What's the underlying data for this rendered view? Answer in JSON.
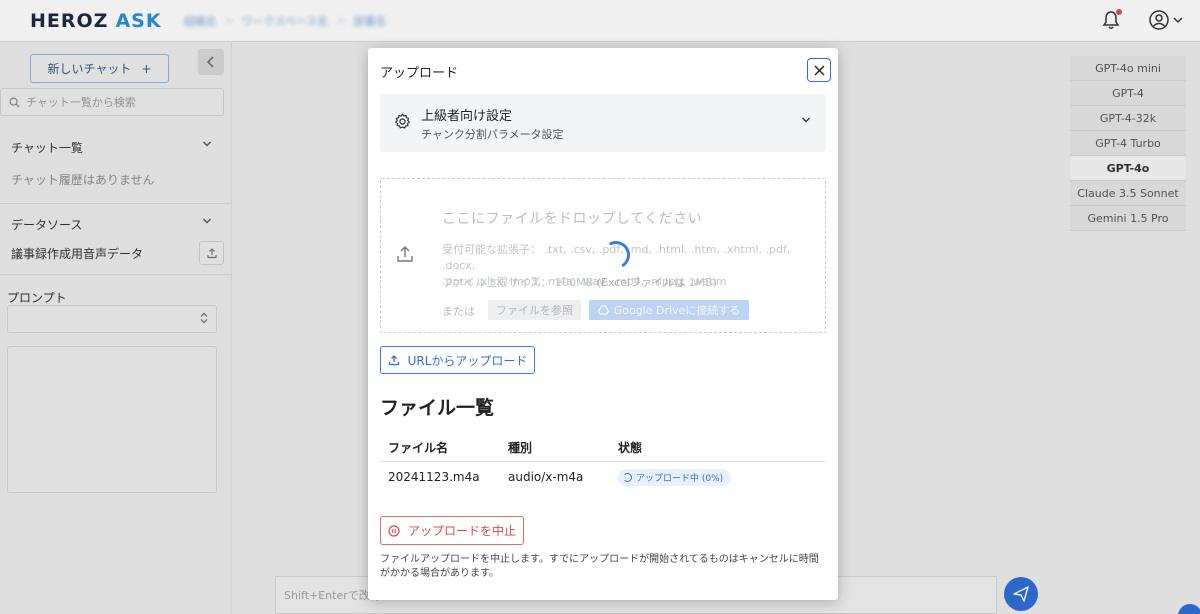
{
  "header": {
    "logo_main": "HEROZ",
    "logo_accent": "ASK",
    "breadcrumbs": [
      "組織名",
      "ワークスペース名",
      "部署名"
    ]
  },
  "sidebar": {
    "new_chat_label": "新しいチャット",
    "new_chat_plus": "+",
    "search_placeholder": "チャット一覧から検索",
    "chat_list_title": "チャット一覧",
    "chat_list_empty": "チャット履歴はありません",
    "datasource_title": "データソース",
    "datasource_item": "議事録作成用音声データ",
    "prompt_title": "プロンプト"
  },
  "main": {
    "input_placeholder": "Shift+Enterで改行"
  },
  "models": [
    "GPT-4o mini",
    "GPT-4",
    "GPT-4-32k",
    "GPT-4 Turbo",
    "GPT-4o",
    "Claude 3.5 Sonnet",
    "Gemini 1.5 Pro"
  ],
  "active_model_index": 4,
  "modal": {
    "title": "アップロード",
    "advanced": {
      "title": "上級者向け設定",
      "subtitle": "チャンク分割パラメータ設定"
    },
    "dropzone": {
      "title": "ここにファイルをドロップしてください",
      "extensions_label": "受付可能な拡張子：",
      "extensions_line1": ".txt, .csv, .pdf, .md, .html, .htm, .xhtml, .pdf, .docx,",
      "extensions_line2": ".pptx, .xlsx, .mp3, .m4a, .wav, .mp4, .mpeg, .webm",
      "size_label": "ファイル上限サイズ：",
      "size_value": "100MB",
      "size_excel": "(Excelファイルは",
      "size_excel_value": "1MB)",
      "or_label": "または",
      "browse_label": "ファイルを参照",
      "gdrive_label": "Google Driveに接続する"
    },
    "url_upload_label": "URLからアップロード",
    "file_list_title": "ファイル一覧",
    "table": {
      "headers": [
        "ファイル名",
        "種別",
        "状態"
      ],
      "rows": [
        {
          "name": "20241123.m4a",
          "type": "audio/x-m4a",
          "status": "アップロード中 (0%)"
        }
      ]
    },
    "cancel_label": "アップロードを中止",
    "cancel_note": "ファイルアップロードを中止します。すでにアップロードが開始されてるものはキャンセルに時間がかかる場合があります。"
  },
  "colors": {
    "accent": "#2f6fd6",
    "danger": "#d14b4b",
    "logo_dark": "#1d2a45",
    "logo_accent": "#2a8fe0"
  }
}
